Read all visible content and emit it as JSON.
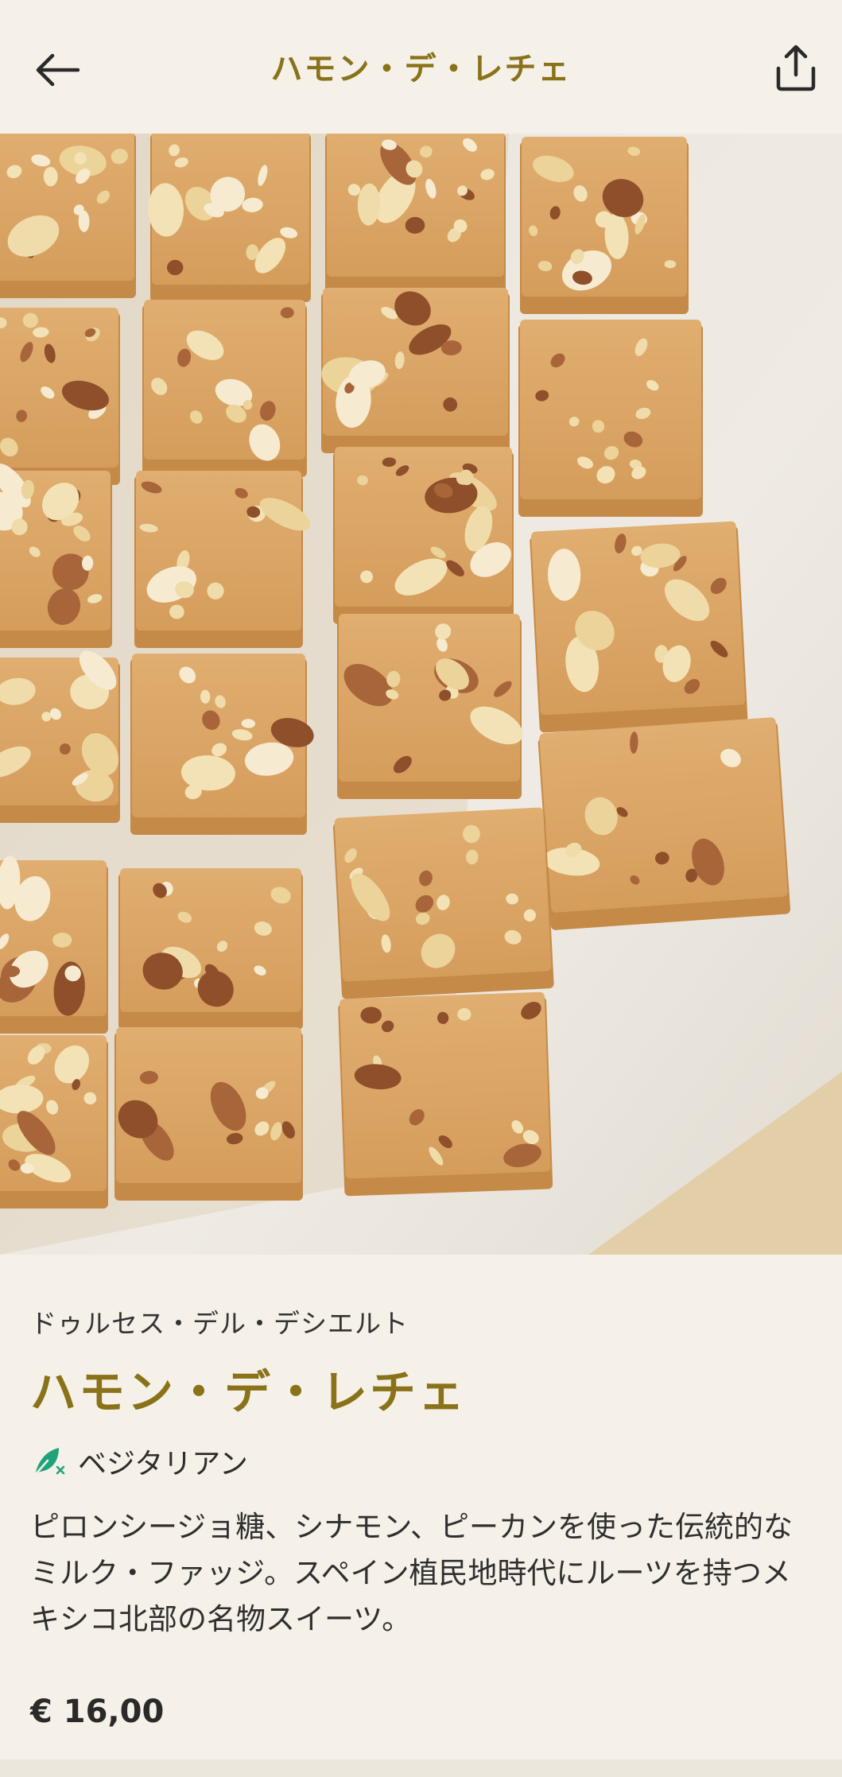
{
  "header": {
    "title": "ハモン・デ・レチェ",
    "back_icon": "arrow-left-icon",
    "share_icon": "share-icon"
  },
  "hero": {
    "description_alt": ""
  },
  "dish": {
    "restaurant": "ドゥルセス・デル・デシエルト",
    "title": "ハモン・デ・レチェ",
    "diet_label": "ベジタリアン",
    "diet_icon": "leaf-icon",
    "description": "ピロンシージョ糖、シナモン、ピーカンを使った伝統的なミルク・ファッジ。スペイン植民地時代にルーツを持つメキシコ北部の名物スイーツ。",
    "price": "€ 16,00"
  },
  "colors": {
    "accent": "#8a7219",
    "background": "#f5f1e9",
    "diet_green": "#1fa37a"
  }
}
